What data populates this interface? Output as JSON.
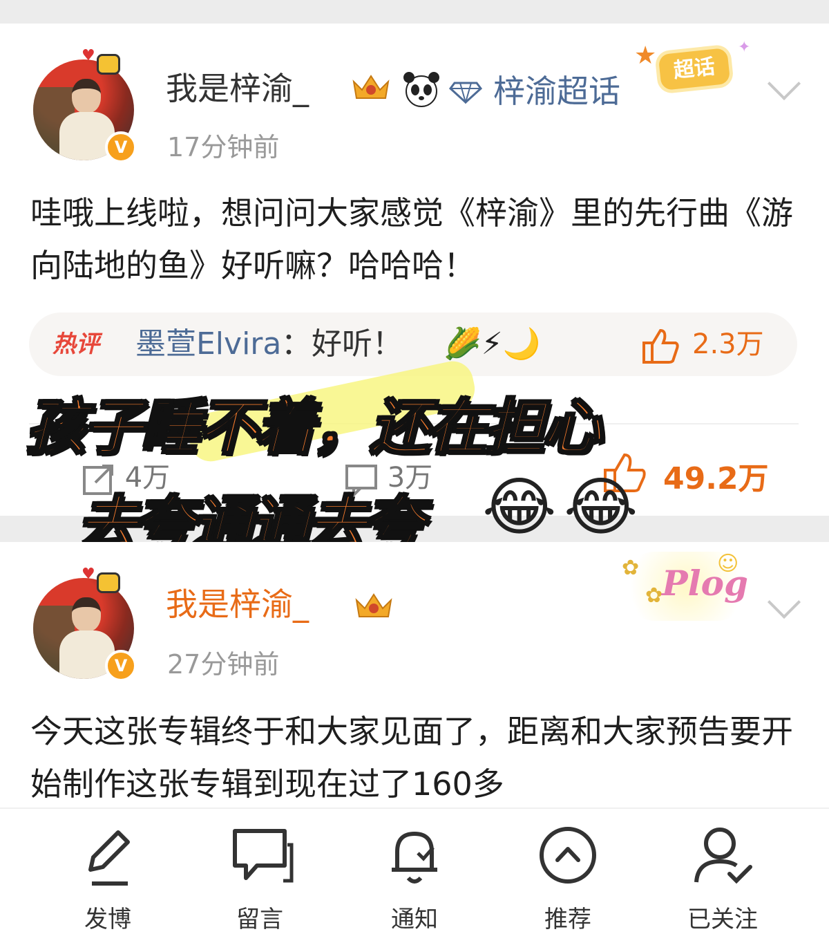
{
  "post1": {
    "username": "我是梓渝_",
    "topic": "梓渝超话",
    "topic_badge": "超话",
    "time": "17分钟前",
    "content": "哇哦上线啦，想问问大家感觉《梓渝》里的先行曲《游向陆地的鱼》好听嘛？哈哈哈！",
    "hot_comment": {
      "tag": "热评",
      "user": "墨萱Elvira",
      "text": "：好听！",
      "emoji": "🌽⚡🌙",
      "likes": "2.3万"
    },
    "actions": {
      "repost": "4万",
      "comment": "3万",
      "likes": "49.2万"
    }
  },
  "overlay": {
    "line1": "孩子睡不着，还在担心",
    "line2": "去夸通通去夸",
    "emoji": "😂"
  },
  "post2": {
    "username": "我是梓渝_",
    "time": "27分钟前",
    "sticker": "Plog",
    "content": "今天这张专辑终于和大家见面了，距离和大家预告要开始制作这张专辑到现在过了160多"
  },
  "tabbar": [
    {
      "icon": "edit-icon",
      "label": "发博"
    },
    {
      "icon": "chat-icon",
      "label": "留言"
    },
    {
      "icon": "bell-icon",
      "label": "通知"
    },
    {
      "icon": "up-icon",
      "label": "推荐"
    },
    {
      "icon": "follow-icon",
      "label": "已关注"
    }
  ],
  "colors": {
    "accent_orange": "#e86b17",
    "link_blue": "#4d6b96",
    "overlay_orange": "#f47a2c",
    "vip_orange": "#f7a01c"
  }
}
